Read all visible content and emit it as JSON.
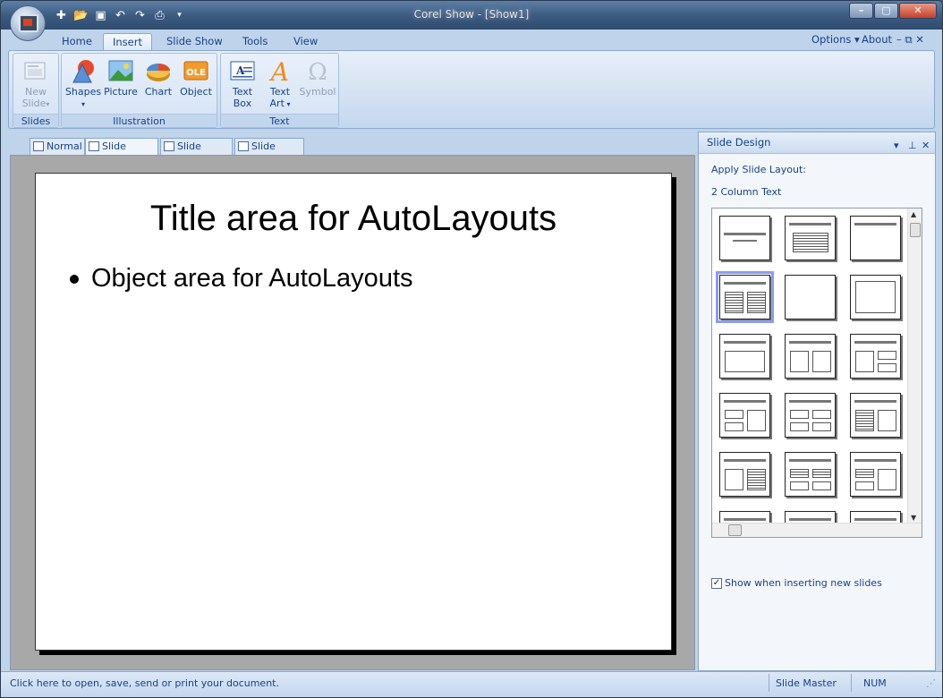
{
  "window": {
    "title": "Corel Show - [Show1]"
  },
  "quick_access": [
    "new-icon",
    "open-icon",
    "save-icon",
    "undo-icon",
    "redo-icon",
    "print-icon",
    "customize-icon"
  ],
  "tabs": [
    {
      "label": "Home",
      "active": false
    },
    {
      "label": "Insert",
      "active": true
    },
    {
      "label": "Slide Show",
      "active": false
    },
    {
      "label": "Tools",
      "active": false
    },
    {
      "label": "View",
      "active": false
    }
  ],
  "top_right": {
    "options": "Options",
    "about": "About"
  },
  "ribbon": {
    "groups": {
      "slides": "Slides",
      "illustration": "Illustration",
      "text": "Text"
    },
    "buttons": {
      "new_slide": "New\nSlide",
      "shapes": "Shapes",
      "picture": "Picture",
      "chart": "Chart",
      "object": "Object",
      "text_box": "Text\nBox",
      "text_art": "Text\nArt",
      "symbol": "Symbol"
    },
    "object_badge": "OLE"
  },
  "view_tabs": [
    "Normal",
    "Slide Master",
    "Slide Sorter",
    "Slide Show"
  ],
  "slide": {
    "title": "Title area for AutoLayouts",
    "body": "Object area for AutoLayouts"
  },
  "pane": {
    "title": "Slide Design",
    "apply_label": "Apply Slide Layout:",
    "selected_layout": "2 Column Text",
    "checkbox_label": "Show when inserting new slides",
    "checkbox_checked": true
  },
  "status": {
    "hint": "Click here to open, save, send or print your document.",
    "mode": "Slide Master",
    "num": "NUM"
  }
}
